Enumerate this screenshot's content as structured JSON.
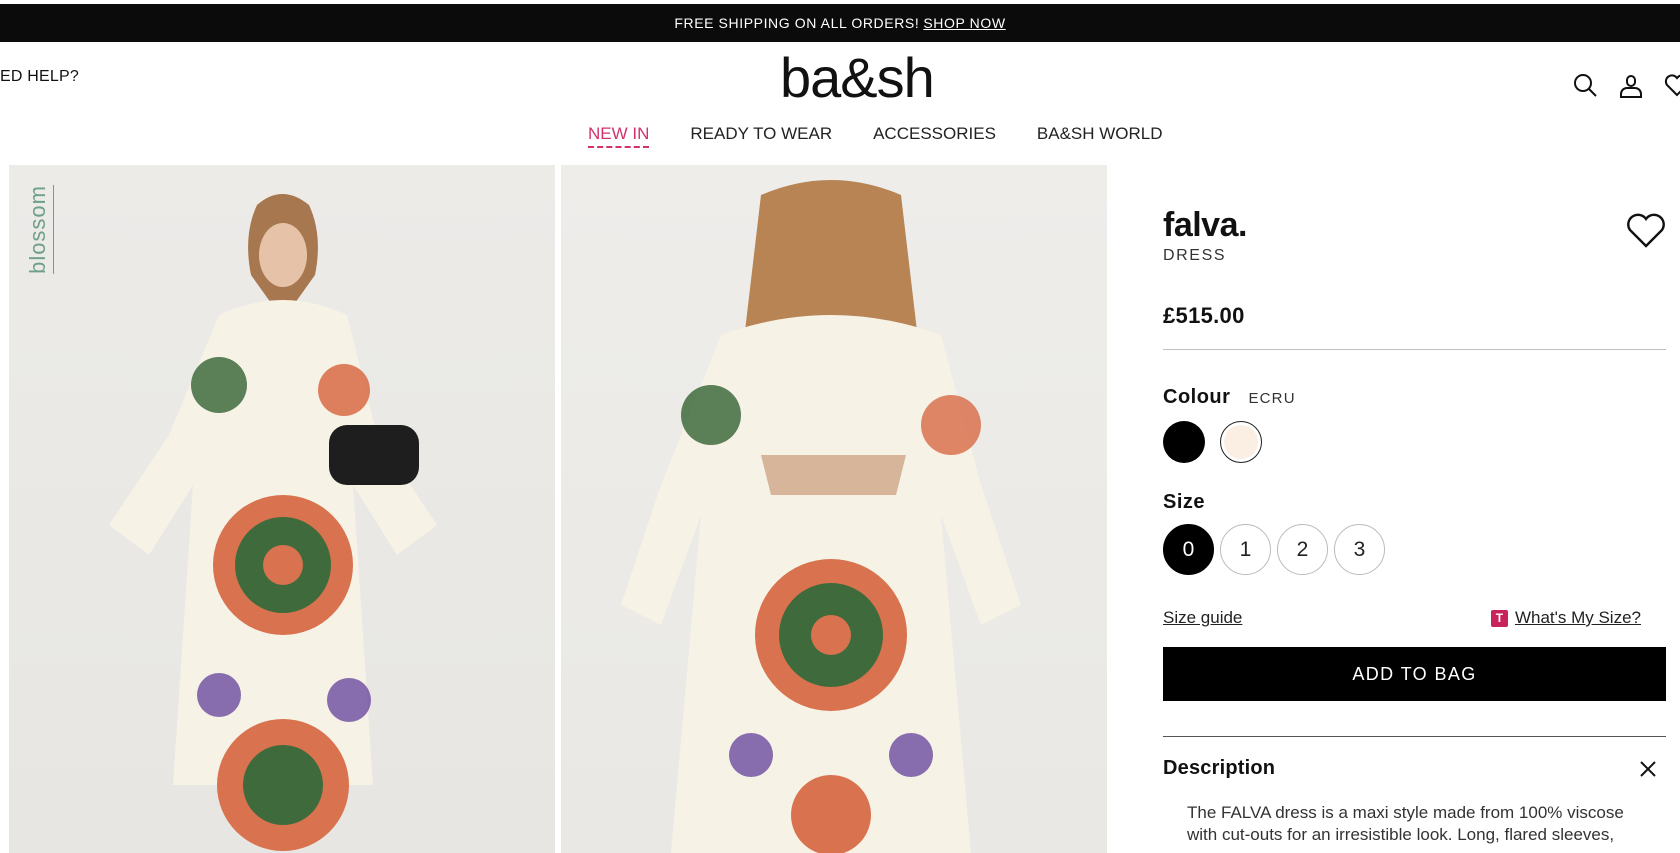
{
  "promo": {
    "text": "FREE SHIPPING ON ALL ORDERS!",
    "link": "SHOP NOW"
  },
  "header": {
    "help": "ED HELP?",
    "logo": "ba&sh",
    "icons": [
      "search-icon",
      "account-icon",
      "wishlist-icon"
    ]
  },
  "nav": {
    "items": [
      "NEW IN",
      "READY TO WEAR",
      "ACCESSORIES",
      "BA&SH WORLD"
    ],
    "active_color": "#d1326d"
  },
  "gallery": {
    "badge": "blossom"
  },
  "product": {
    "name": "falva.",
    "type": "DRESS",
    "price": "£515.00",
    "colour_label": "Colour",
    "colour_value": "ECRU",
    "swatches": [
      {
        "name": "black",
        "color": "#000000"
      },
      {
        "name": "ecru",
        "color": "#fbeee3"
      }
    ],
    "size_label": "Size",
    "sizes": [
      "0",
      "1",
      "2",
      "3"
    ],
    "selected_size": "0",
    "size_guide": "Size guide",
    "whats_my_size_badge": "T",
    "whats_my_size": "What's My Size?",
    "add_to_bag": "ADD TO BAG",
    "description_label": "Description",
    "description_line1": "The FALVA dress is a maxi style made from 100% viscose",
    "description_line2": "with cut-outs for an irresistible look. Long, flared sleeves,"
  }
}
